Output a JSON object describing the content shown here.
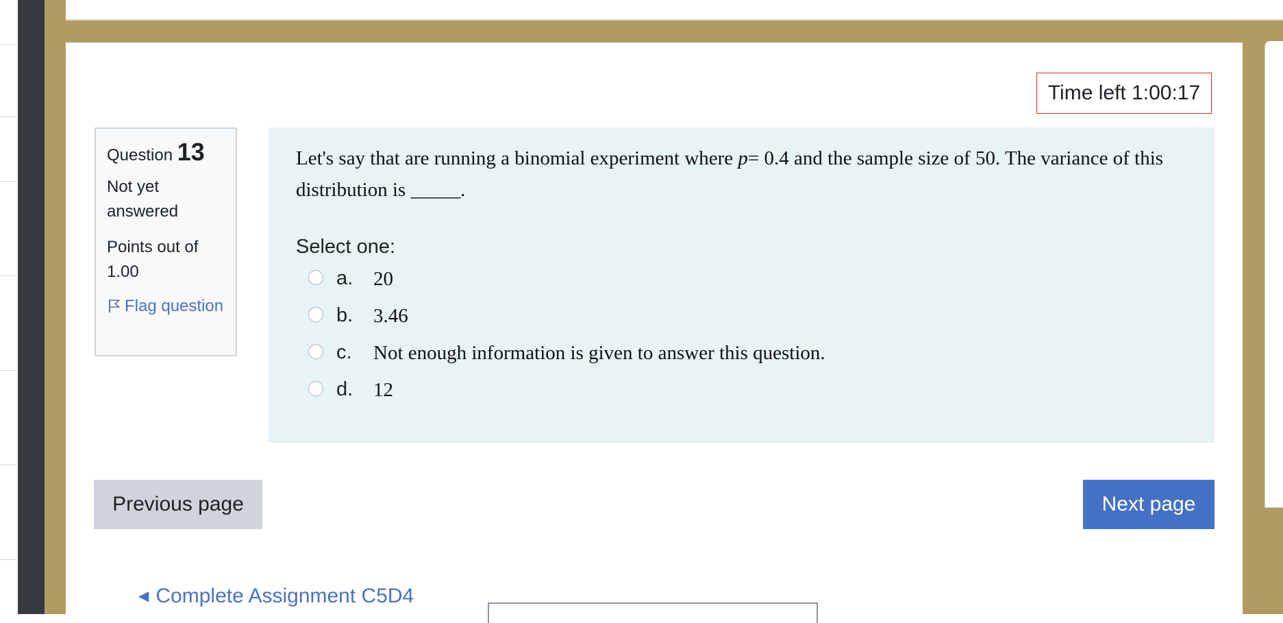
{
  "timer": {
    "label": "Time left",
    "value": "1:00:17"
  },
  "question_info": {
    "label": "Question",
    "number": "13",
    "state": "Not yet answered",
    "grade": "Points out of 1.00",
    "flag_label": "Flag question"
  },
  "question": {
    "text_before": "Let's say that are running a binomial experiment where ",
    "variable": "p",
    "text_after": "= 0.4 and the sample size of 50. The variance of this distribution is _____.",
    "prompt": "Select one:",
    "answers": [
      {
        "letter": "a.",
        "text": "20"
      },
      {
        "letter": "b.",
        "text": "3.46"
      },
      {
        "letter": "c.",
        "text": "Not enough information is given to answer this question."
      },
      {
        "letter": "d.",
        "text": "12"
      }
    ]
  },
  "navigation": {
    "previous_label": "Previous page",
    "next_label": "Next page",
    "previous_activity": "Complete Assignment C5D4"
  },
  "colors": {
    "frame": "#b09b62",
    "dark_bar": "#343a40",
    "formulation_bg": "#e7f3f5",
    "primary_button": "#4571c4",
    "secondary_button": "#ced4da",
    "link": "#4a72bf",
    "timer_border": "#ca3120"
  }
}
